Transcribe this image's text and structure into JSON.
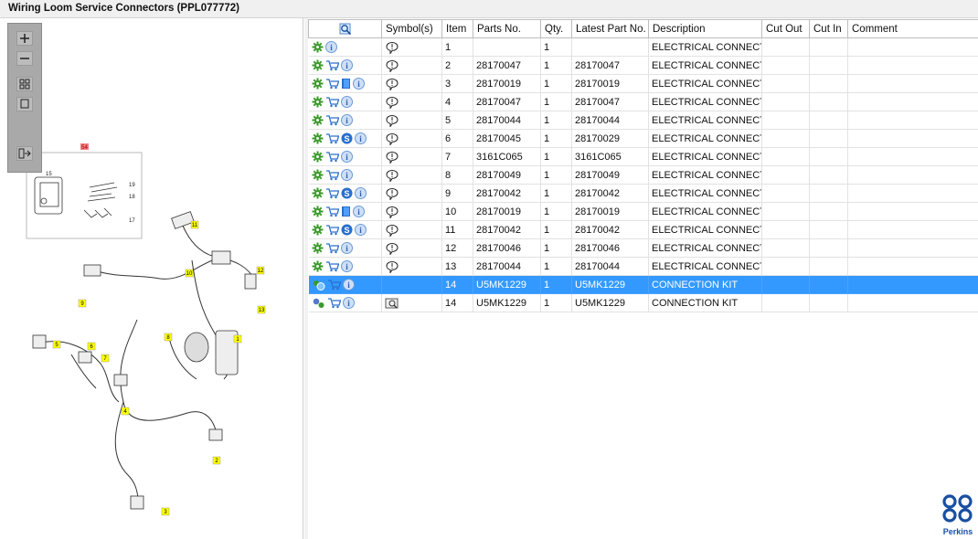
{
  "window": {
    "title": "Wiring Loom Service Connectors (PPL077772)"
  },
  "toolbar": {
    "icons": [
      "zoom-in-icon",
      "zoom-out-icon",
      "thumbnails-icon",
      "fit-icon",
      "list-export-icon"
    ]
  },
  "diagram": {
    "inset_label": "54",
    "inset_callouts": [
      "15",
      "19",
      "18",
      "17"
    ],
    "callouts": [
      "11",
      "12",
      "10",
      "13",
      "9",
      "8",
      "1",
      "5",
      "6",
      "7",
      "4",
      "2",
      "3"
    ]
  },
  "table": {
    "columns": [
      "",
      "Symbol(s)",
      "Item",
      "Parts No.",
      "Qty.",
      "Latest Part No.",
      "Description",
      "Cut Out",
      "Cut In",
      "Comment"
    ],
    "rows": [
      {
        "icons": [
          "gear",
          "info"
        ],
        "item": "1",
        "part": "",
        "qty": "1",
        "latest": "",
        "desc": "ELECTRICAL CONNECTO",
        "sym": "bubble",
        "selected": false
      },
      {
        "icons": [
          "gear",
          "cart",
          "info"
        ],
        "item": "2",
        "part": "28170047",
        "qty": "1",
        "latest": "28170047",
        "desc": "ELECTRICAL CONNECTO",
        "sym": "bubble",
        "selected": false
      },
      {
        "icons": [
          "gear",
          "cart",
          "book",
          "info"
        ],
        "item": "3",
        "part": "28170019",
        "qty": "1",
        "latest": "28170019",
        "desc": "ELECTRICAL CONNECTO",
        "sym": "bubble",
        "selected": false
      },
      {
        "icons": [
          "gear",
          "cart",
          "info"
        ],
        "item": "4",
        "part": "28170047",
        "qty": "1",
        "latest": "28170047",
        "desc": "ELECTRICAL CONNECTO",
        "sym": "bubble",
        "selected": false
      },
      {
        "icons": [
          "gear",
          "cart",
          "info"
        ],
        "item": "5",
        "part": "28170044",
        "qty": "1",
        "latest": "28170044",
        "desc": "ELECTRICAL CONNECTO",
        "sym": "bubble",
        "selected": false
      },
      {
        "icons": [
          "gear",
          "cart",
          "s",
          "info"
        ],
        "item": "6",
        "part": "28170045",
        "qty": "1",
        "latest": "28170029",
        "desc": "ELECTRICAL CONNECTO",
        "sym": "bubble",
        "selected": false
      },
      {
        "icons": [
          "gear",
          "cart",
          "info"
        ],
        "item": "7",
        "part": "3161C065",
        "qty": "1",
        "latest": "3161C065",
        "desc": "ELECTRICAL CONNECTO",
        "sym": "bubble",
        "selected": false
      },
      {
        "icons": [
          "gear",
          "cart",
          "info"
        ],
        "item": "8",
        "part": "28170049",
        "qty": "1",
        "latest": "28170049",
        "desc": "ELECTRICAL CONNECTO",
        "sym": "bubble",
        "selected": false
      },
      {
        "icons": [
          "gear",
          "cart",
          "s",
          "info"
        ],
        "item": "9",
        "part": "28170042",
        "qty": "1",
        "latest": "28170042",
        "desc": "ELECTRICAL CONNECTO",
        "sym": "bubble",
        "selected": false
      },
      {
        "icons": [
          "gear",
          "cart",
          "book",
          "info"
        ],
        "item": "10",
        "part": "28170019",
        "qty": "1",
        "latest": "28170019",
        "desc": "ELECTRICAL CONNECTO",
        "sym": "bubble",
        "selected": false
      },
      {
        "icons": [
          "gear",
          "cart",
          "s",
          "info"
        ],
        "item": "11",
        "part": "28170042",
        "qty": "1",
        "latest": "28170042",
        "desc": "ELECTRICAL CONNECTO",
        "sym": "bubble",
        "selected": false
      },
      {
        "icons": [
          "gear",
          "cart",
          "info"
        ],
        "item": "12",
        "part": "28170046",
        "qty": "1",
        "latest": "28170046",
        "desc": "ELECTRICAL CONNECTO",
        "sym": "bubble",
        "selected": false
      },
      {
        "icons": [
          "gear",
          "cart",
          "info"
        ],
        "item": "13",
        "part": "28170044",
        "qty": "1",
        "latest": "28170044",
        "desc": "ELECTRICAL CONNECTO",
        "sym": "bubble",
        "selected": false
      },
      {
        "icons": [
          "gear-globe",
          "cart",
          "info"
        ],
        "item": "14",
        "part": "U5MK1229",
        "qty": "1",
        "latest": "U5MK1229",
        "desc": "CONNECTION KIT",
        "sym": "",
        "selected": true
      },
      {
        "icons": [
          "gears",
          "cart",
          "info"
        ],
        "item": "14",
        "part": "U5MK1229",
        "qty": "1",
        "latest": "U5MK1229",
        "desc": "CONNECTION KIT",
        "sym": "book-search",
        "selected": false
      }
    ]
  },
  "brand": {
    "name": "Perkins",
    "color": "#1a4fa0"
  },
  "colors": {
    "selection": "#3399ff",
    "gear": "#3a9a2a",
    "info": "#6a9ad8",
    "callout": "#ffff00",
    "inset_label": "#f08080"
  }
}
